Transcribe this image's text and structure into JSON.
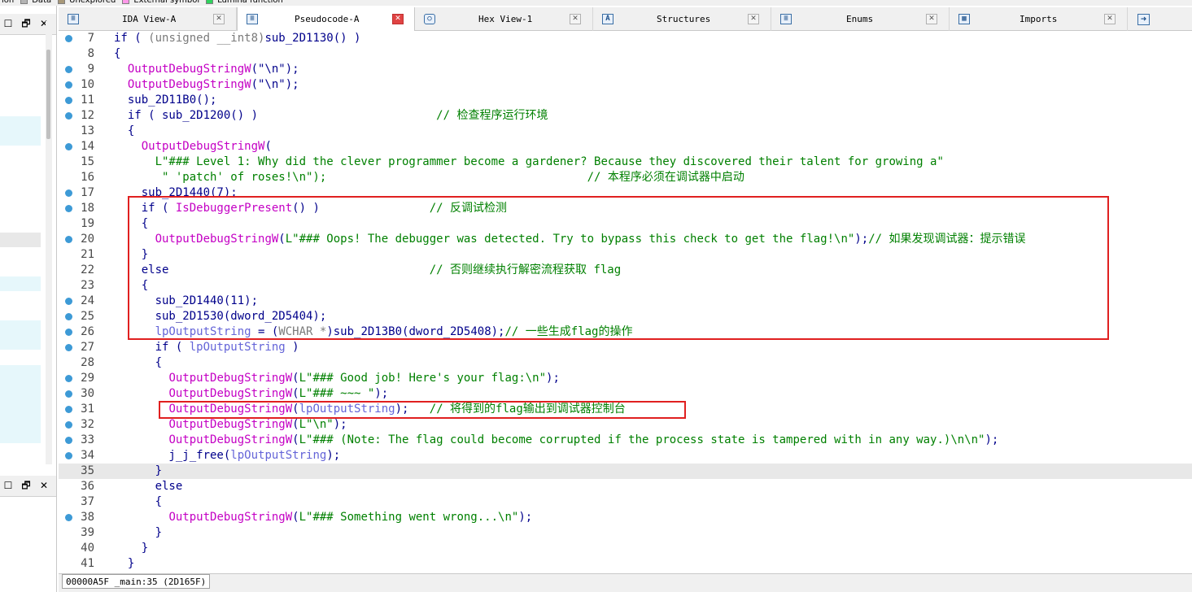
{
  "legend": [
    {
      "label": "ion",
      "color": "#f4f4f4"
    },
    {
      "label": "Data",
      "color": "#b4b4b4"
    },
    {
      "label": "Unexplored",
      "color": "#a89878"
    },
    {
      "label": "External symbol",
      "color": "#ff98e8"
    },
    {
      "label": "Lumina function",
      "color": "#2fd25d"
    }
  ],
  "left_panel": {
    "top_buttons": [
      "☐",
      "🗗",
      "✕"
    ],
    "bottom_buttons": [
      "☐",
      "🗗",
      "✕"
    ]
  },
  "tabs": [
    {
      "label": "IDA View-A",
      "icon": "ida-view-icon",
      "icon_glyph": "≡",
      "active": false,
      "close_red": false
    },
    {
      "label": "Pseudocode-A",
      "icon": "pseudocode-icon",
      "icon_glyph": "≡",
      "active": true,
      "close_red": true
    },
    {
      "label": "Hex View-1",
      "icon": "hex-view-icon",
      "icon_glyph": "○",
      "active": false,
      "close_red": false
    },
    {
      "label": "Structures",
      "icon": "structures-icon",
      "icon_glyph": "A",
      "active": false,
      "close_red": false
    },
    {
      "label": "Enums",
      "icon": "enums-icon",
      "icon_glyph": "≡",
      "active": false,
      "close_red": false
    },
    {
      "label": "Imports",
      "icon": "imports-icon",
      "icon_glyph": "▦",
      "active": false,
      "close_red": false
    }
  ],
  "close_glyph": "✕",
  "exports_icon_glyph": "➜",
  "code_lines": [
    {
      "num": "7",
      "dot": true,
      "hl": false,
      "tokens": [
        [
          "t",
          "if ( "
        ],
        [
          "type",
          "(unsigned __int8)"
        ],
        [
          "t",
          "sub_2D1130() )"
        ]
      ]
    },
    {
      "num": "8",
      "dot": false,
      "hl": false,
      "tokens": [
        [
          "t",
          "{"
        ]
      ]
    },
    {
      "num": "9",
      "dot": true,
      "hl": false,
      "tokens": [
        [
          "t",
          "  "
        ],
        [
          "pink",
          "OutputDebugStringW"
        ],
        [
          "t",
          "(\"\\n\");"
        ]
      ]
    },
    {
      "num": "10",
      "dot": true,
      "hl": false,
      "tokens": [
        [
          "t",
          "  "
        ],
        [
          "pink",
          "OutputDebugStringW"
        ],
        [
          "t",
          "(\"\\n\");"
        ]
      ]
    },
    {
      "num": "11",
      "dot": true,
      "hl": false,
      "tokens": [
        [
          "t",
          "  sub_2D11B0();"
        ]
      ]
    },
    {
      "num": "12",
      "dot": true,
      "hl": false,
      "tokens": [
        [
          "t",
          "  if ( sub_2D1200() )                          "
        ],
        [
          "cmt",
          "// 检查程序运行环境"
        ]
      ]
    },
    {
      "num": "13",
      "dot": false,
      "hl": false,
      "tokens": [
        [
          "t",
          "  {"
        ]
      ]
    },
    {
      "num": "14",
      "dot": true,
      "hl": false,
      "tokens": [
        [
          "t",
          "    "
        ],
        [
          "pink",
          "OutputDebugStringW"
        ],
        [
          "t",
          "("
        ]
      ]
    },
    {
      "num": "15",
      "dot": false,
      "hl": false,
      "tokens": [
        [
          "str",
          "      L\"### Level 1: Why did the clever programmer become a gardener? Because they discovered their talent for growing a\""
        ]
      ]
    },
    {
      "num": "16",
      "dot": false,
      "hl": false,
      "tokens": [
        [
          "str",
          "       \" 'patch' of roses!\\n\");"
        ],
        [
          "t",
          "                                      "
        ],
        [
          "cmt",
          "// 本程序必须在调试器中启动"
        ]
      ]
    },
    {
      "num": "17",
      "dot": true,
      "hl": false,
      "tokens": [
        [
          "t",
          "    sub_2D1440(7);"
        ]
      ]
    },
    {
      "num": "18",
      "dot": true,
      "hl": false,
      "tokens": [
        [
          "t",
          "    if ( "
        ],
        [
          "pink",
          "IsDebuggerPresent"
        ],
        [
          "t",
          "() )                "
        ],
        [
          "cmt",
          "// 反调试检测"
        ]
      ]
    },
    {
      "num": "19",
      "dot": false,
      "hl": false,
      "tokens": [
        [
          "t",
          "    {"
        ]
      ]
    },
    {
      "num": "20",
      "dot": true,
      "hl": false,
      "tokens": [
        [
          "t",
          "      "
        ],
        [
          "pink",
          "OutputDebugStringW"
        ],
        [
          "t",
          "("
        ],
        [
          "str",
          "L\"### Oops! The debugger was detected. Try to bypass this check to get the flag!\\n\""
        ],
        [
          "t",
          ");"
        ],
        [
          "cmt",
          "// 如果发现调试器：提示错误"
        ]
      ]
    },
    {
      "num": "21",
      "dot": false,
      "hl": false,
      "tokens": [
        [
          "t",
          "    }"
        ]
      ]
    },
    {
      "num": "22",
      "dot": false,
      "hl": false,
      "tokens": [
        [
          "t",
          "    else                                      "
        ],
        [
          "cmt",
          "// 否则继续执行解密流程获取 flag"
        ]
      ]
    },
    {
      "num": "23",
      "dot": false,
      "hl": false,
      "tokens": [
        [
          "t",
          "    {"
        ]
      ]
    },
    {
      "num": "24",
      "dot": true,
      "hl": false,
      "tokens": [
        [
          "t",
          "      sub_2D1440(11);"
        ]
      ]
    },
    {
      "num": "25",
      "dot": true,
      "hl": false,
      "tokens": [
        [
          "t",
          "      sub_2D1530(dword_2D5404);"
        ]
      ]
    },
    {
      "num": "26",
      "dot": true,
      "hl": false,
      "tokens": [
        [
          "t",
          "      "
        ],
        [
          "var",
          "lpOutputString"
        ],
        [
          "t",
          " = ("
        ],
        [
          "type",
          "WCHAR *"
        ],
        [
          "t",
          ")sub_2D13B0(dword_2D5408);"
        ],
        [
          "cmt",
          "// 一些生成flag的操作"
        ]
      ]
    },
    {
      "num": "27",
      "dot": true,
      "hl": false,
      "tokens": [
        [
          "t",
          "      if ( "
        ],
        [
          "var",
          "lpOutputString"
        ],
        [
          "t",
          " )"
        ]
      ]
    },
    {
      "num": "28",
      "dot": false,
      "hl": false,
      "tokens": [
        [
          "t",
          "      {"
        ]
      ]
    },
    {
      "num": "29",
      "dot": true,
      "hl": false,
      "tokens": [
        [
          "t",
          "        "
        ],
        [
          "pink",
          "OutputDebugStringW"
        ],
        [
          "t",
          "("
        ],
        [
          "str",
          "L\"### Good job! Here's your flag:\\n\""
        ],
        [
          "t",
          ");"
        ]
      ]
    },
    {
      "num": "30",
      "dot": true,
      "hl": false,
      "tokens": [
        [
          "t",
          "        "
        ],
        [
          "pink",
          "OutputDebugStringW"
        ],
        [
          "t",
          "("
        ],
        [
          "str",
          "L\"### ~~~ \""
        ],
        [
          "t",
          ");"
        ]
      ]
    },
    {
      "num": "31",
      "dot": true,
      "hl": false,
      "tokens": [
        [
          "t",
          "        "
        ],
        [
          "pink",
          "OutputDebugStringW"
        ],
        [
          "t",
          "("
        ],
        [
          "var",
          "lpOutputString"
        ],
        [
          "t",
          ");   "
        ],
        [
          "cmt",
          "// 将得到的flag输出到调试器控制台"
        ]
      ]
    },
    {
      "num": "32",
      "dot": true,
      "hl": false,
      "tokens": [
        [
          "t",
          "        "
        ],
        [
          "pink",
          "OutputDebugStringW"
        ],
        [
          "t",
          "("
        ],
        [
          "str",
          "L\"\\n\""
        ],
        [
          "t",
          ");"
        ]
      ]
    },
    {
      "num": "33",
      "dot": true,
      "hl": false,
      "tokens": [
        [
          "t",
          "        "
        ],
        [
          "pink",
          "OutputDebugStringW"
        ],
        [
          "t",
          "("
        ],
        [
          "str",
          "L\"### (Note: The flag could become corrupted if the process state is tampered with in any way.)\\n\\n\""
        ],
        [
          "t",
          ");"
        ]
      ]
    },
    {
      "num": "34",
      "dot": true,
      "hl": false,
      "tokens": [
        [
          "t",
          "        j_j_free("
        ],
        [
          "var",
          "lpOutputString"
        ],
        [
          "t",
          ");"
        ]
      ]
    },
    {
      "num": "35",
      "dot": false,
      "hl": true,
      "tokens": [
        [
          "t",
          "      }"
        ]
      ]
    },
    {
      "num": "36",
      "dot": false,
      "hl": false,
      "tokens": [
        [
          "t",
          "      else"
        ]
      ]
    },
    {
      "num": "37",
      "dot": false,
      "hl": false,
      "tokens": [
        [
          "t",
          "      {"
        ]
      ]
    },
    {
      "num": "38",
      "dot": true,
      "hl": false,
      "tokens": [
        [
          "t",
          "        "
        ],
        [
          "pink",
          "OutputDebugStringW"
        ],
        [
          "t",
          "("
        ],
        [
          "str",
          "L\"### Something went wrong...\\n\""
        ],
        [
          "t",
          ");"
        ]
      ]
    },
    {
      "num": "39",
      "dot": false,
      "hl": false,
      "tokens": [
        [
          "t",
          "      }"
        ]
      ]
    },
    {
      "num": "40",
      "dot": false,
      "hl": false,
      "tokens": [
        [
          "t",
          "    }"
        ]
      ]
    },
    {
      "num": "41",
      "dot": false,
      "hl": false,
      "tokens": [
        [
          "t",
          "  }"
        ]
      ]
    }
  ],
  "status_bar": {
    "text": "00000A5F _main:35 (2D165F)"
  },
  "colors": {
    "keyword": "#00008b",
    "api": "#c400c4",
    "string": "#008000",
    "comment": "#008000",
    "variable": "#6464d8",
    "line_dot": "#3d9ad6",
    "annotation": "#e02020"
  }
}
